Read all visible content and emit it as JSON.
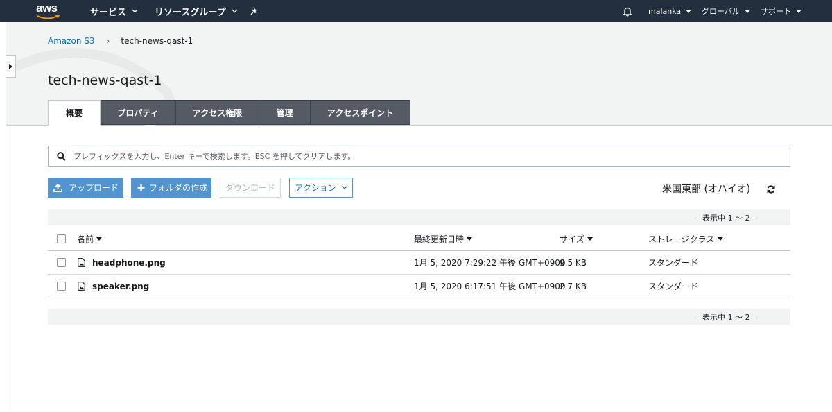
{
  "topnav": {
    "logo": "aws",
    "services": "サービス",
    "resource_groups": "リソースグループ",
    "pin_icon": "pin-icon",
    "bell_icon": "bell-icon",
    "user": "malanka",
    "region": "グローバル",
    "support": "サポート"
  },
  "breadcrumb": {
    "root": "Amazon S3",
    "separator": "›",
    "current": "tech-news-qast-1"
  },
  "page": {
    "title": "tech-news-qast-1"
  },
  "tabs": [
    {
      "label": "概要",
      "active": true
    },
    {
      "label": "プロパティ",
      "active": false
    },
    {
      "label": "アクセス権限",
      "active": false
    },
    {
      "label": "管理",
      "active": false
    },
    {
      "label": "アクセスポイント",
      "active": false
    }
  ],
  "search": {
    "placeholder": "プレフィックスを入力し、Enter キーで検索します。ESC を押してクリアします。",
    "value": ""
  },
  "actions": {
    "upload": "アップロード",
    "create_folder": "フォルダの作成",
    "download": "ダウンロード",
    "action": "アクション"
  },
  "region_label": "米国東部 (オハイオ)",
  "pager": {
    "text": "表示中 1 ～ 2",
    "prev": "‹",
    "next": "›"
  },
  "table": {
    "columns": [
      "名前",
      "最終更新日時",
      "サイズ",
      "ストレージクラス"
    ],
    "rows": [
      {
        "name": "headphone.png",
        "modified": "1月 5, 2020 7:29:22 午後 GMT+0900",
        "size": "9.5 KB",
        "storage": "スタンダード"
      },
      {
        "name": "speaker.png",
        "modified": "1月 5, 2020 6:17:51 午後 GMT+0900",
        "size": "2.7 KB",
        "storage": "スタンダード"
      }
    ]
  },
  "colors": {
    "nav_bg": "#232f3e",
    "accent": "#5294cf",
    "link": "#0073bb",
    "tab_inactive": "#545b64"
  }
}
